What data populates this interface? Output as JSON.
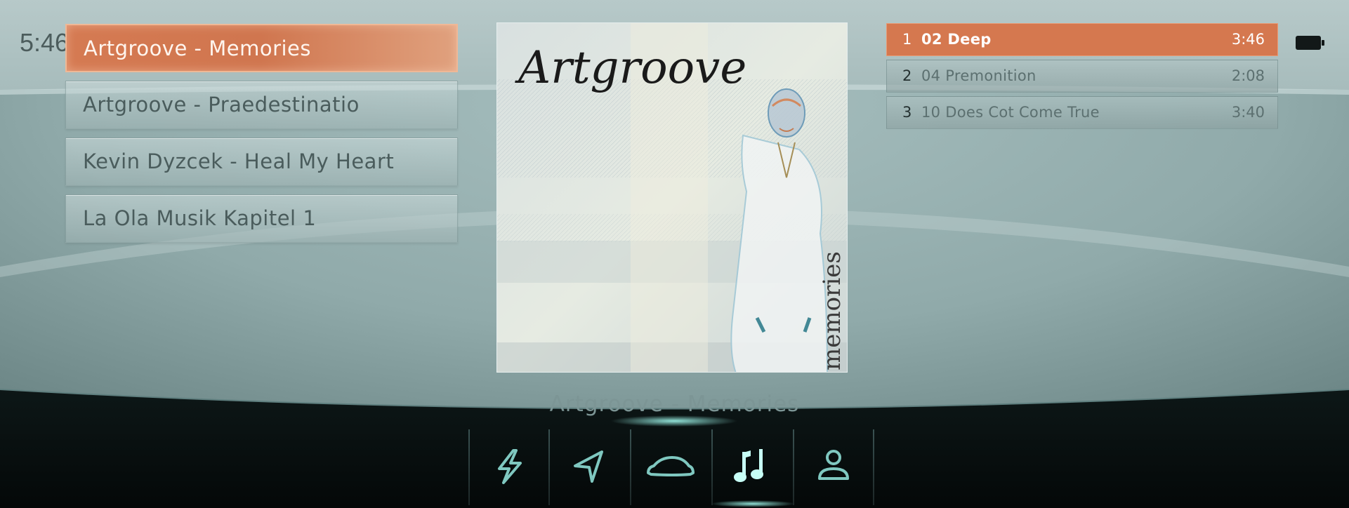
{
  "status_bar": {
    "time": "5:46"
  },
  "albums": [
    {
      "label": "Artgroove - Memories",
      "selected": true
    },
    {
      "label": "Artgroove - Praedestinatio",
      "selected": false
    },
    {
      "label": "Kevin Dyzcek - Heal My Heart",
      "selected": false
    },
    {
      "label": "La Ola Musik Kapitel 1",
      "selected": false
    }
  ],
  "cover": {
    "title_text": "Artgroove",
    "subtitle_text": "memories"
  },
  "now_playing": {
    "label": "Artgroove - Memories"
  },
  "tracks": [
    {
      "number": "1",
      "title": "02 Deep",
      "duration": "3:46",
      "selected": true
    },
    {
      "number": "2",
      "title": "04 Premonition",
      "duration": "2:08",
      "selected": false
    },
    {
      "number": "3",
      "title": "10 Does Cot Come True",
      "duration": "3:40",
      "selected": false
    }
  ],
  "dock": [
    {
      "icon": "lightning-icon",
      "label": "Charging",
      "active": false
    },
    {
      "icon": "navigation-arrow-icon",
      "label": "Navigation",
      "active": false
    },
    {
      "icon": "car-icon",
      "label": "Vehicle",
      "active": false
    },
    {
      "icon": "music-note-icon",
      "label": "Media",
      "active": true
    },
    {
      "icon": "user-icon",
      "label": "Profile",
      "active": false
    }
  ],
  "colors": {
    "accent": "#d5784f",
    "teal_glow": "#7ff0e0",
    "icon_normal": "#7fc8c0",
    "background_teal": "#a9bebe"
  }
}
